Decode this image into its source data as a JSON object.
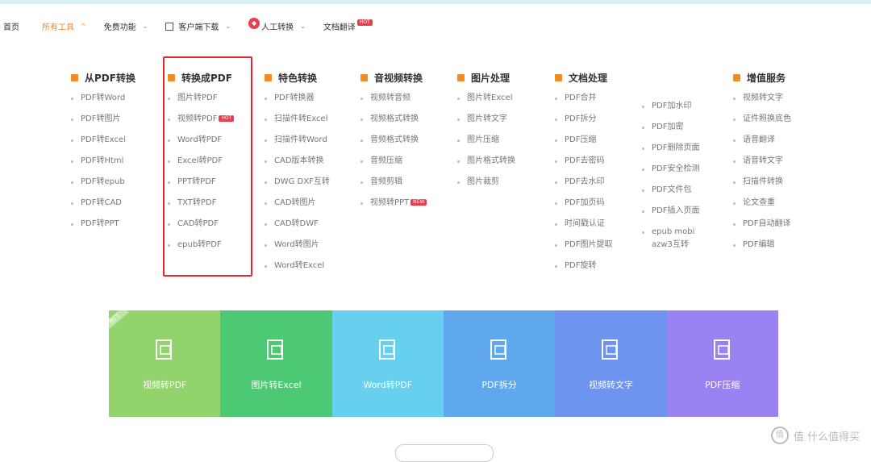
{
  "nav": {
    "items": [
      {
        "label": "首页"
      },
      {
        "label": "所有工具"
      },
      {
        "label": "免费功能"
      },
      {
        "label": "客户端下载"
      },
      {
        "label": "人工转换"
      },
      {
        "label": "文档翻译",
        "badge": "HOT"
      }
    ]
  },
  "menu": {
    "columns": [
      {
        "title": "从PDF转换",
        "items": [
          "PDF转Word",
          "PDF转图片",
          "PDF转Excel",
          "PDF转Html",
          "PDF转epub",
          "PDF转CAD",
          "PDF转PPT"
        ]
      },
      {
        "title": "转换成PDF",
        "items": [
          "图片转PDF",
          "视频转PDF",
          "Word转PDF",
          "Excel转PDF",
          "PPT转PDF",
          "TXT转PDF",
          "CAD转PDF",
          "epub转PDF"
        ],
        "badge_item": 1,
        "badge": "HOT"
      },
      {
        "title": "特色转换",
        "items": [
          "PDF转换器",
          "扫描件转Excel",
          "扫描件转Word",
          "CAD版本转换",
          "DWG DXF互转",
          "CAD转图片",
          "CAD转DWF",
          "Word转图片",
          "Word转Excel"
        ]
      },
      {
        "title": "音视频转换",
        "items": [
          "视频转音频",
          "视频格式转换",
          "音频格式转换",
          "音频压缩",
          "音频剪辑",
          "视频转PPT"
        ],
        "badge_item": 5,
        "badge": "NEW"
      },
      {
        "title": "图片处理",
        "items": [
          "图片转Excel",
          "图片转文字",
          "图片压缩",
          "图片格式转换",
          "图片裁剪"
        ]
      },
      {
        "title": "文档处理",
        "items": [
          "PDF合并",
          "PDF拆分",
          "PDF压缩",
          "PDF去密码",
          "PDF去水印",
          "PDF加页码",
          "时间戳认证",
          "PDF图片提取",
          "PDF旋转"
        ]
      },
      {
        "title": "",
        "items": [
          "PDF加水印",
          "PDF加密",
          "PDF删除页面",
          "PDF安全检测",
          "PDF文件包",
          "PDF插入页面",
          "epub mobi azw3互转"
        ]
      },
      {
        "title": "增值服务",
        "items": [
          "视频转文字",
          "证件照换底色",
          "语音翻译",
          "语音转文字",
          "扫描件转换",
          "论文查重",
          "PDF自动翻译",
          "PDF编辑"
        ]
      }
    ]
  },
  "cards": [
    {
      "label": "视频转PDF",
      "color": "#92d46b",
      "hot": "热门"
    },
    {
      "label": "图片转Excel",
      "color": "#4dc873"
    },
    {
      "label": "Word转PDF",
      "color": "#67d0ee"
    },
    {
      "label": "PDF拆分",
      "color": "#5fa8ee"
    },
    {
      "label": "视频转文字",
      "color": "#6e94f0"
    },
    {
      "label": "PDF压缩",
      "color": "#9b82f2"
    }
  ],
  "watermark": "值 什么值得买",
  "colors": {
    "accent": "#f08a24",
    "highlight_box": "#e8262b"
  }
}
